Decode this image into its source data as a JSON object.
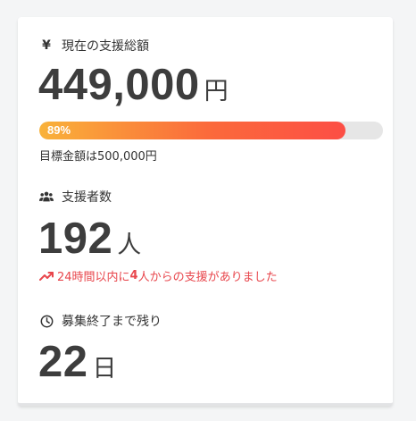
{
  "funding": {
    "label": "現在の支援総額",
    "icon": "yen-icon",
    "amount": "449,000",
    "unit": "円",
    "progress_percent": 89,
    "progress_label": "89%",
    "goal_text": "目標金額は500,000円"
  },
  "backers": {
    "label": "支援者数",
    "icon": "people-icon",
    "count": "192",
    "unit": "人",
    "recent_prefix": "24時間以内に",
    "recent_count": "4",
    "recent_suffix": "人からの支援がありました",
    "recent_icon": "trending-up-icon"
  },
  "remaining": {
    "label": "募集終了まで残り",
    "icon": "clock-icon",
    "days": "22",
    "unit": "日"
  },
  "colors": {
    "accent_red": "#e8464c",
    "progress_start": "#f9b23a",
    "progress_end": "#fc4e45",
    "text": "#3d3d3d"
  }
}
